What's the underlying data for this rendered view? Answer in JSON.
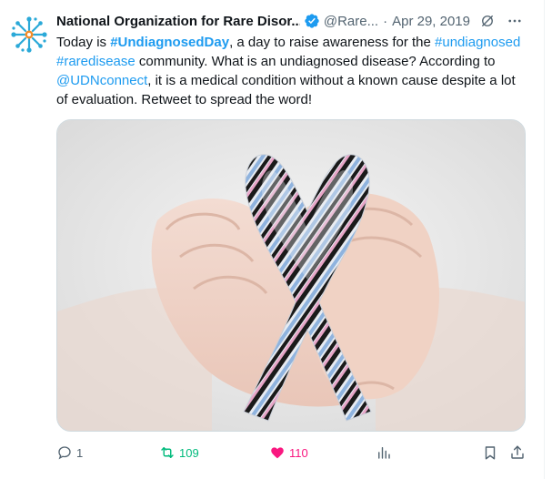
{
  "tweet": {
    "author_name": "National Organization for Rare Disor...",
    "handle": "@Rare...",
    "separator": "·",
    "date": "Apr 29, 2019",
    "text_parts": {
      "p1": "Today is ",
      "tag1": "#UndiagnosedDay",
      "p2": ", a day to raise awareness for the ",
      "tag2": "#undiagnosed",
      "p3": " ",
      "tag3": "#raredisease",
      "p4": " community. What is an undiagnosed disease? According to ",
      "mention": "@UDNconnect",
      "p5": ", it is a medical condition without a known cause despite a lot of evaluation. Retweet to spread the word!"
    },
    "media": {
      "icon": "hands-holding-zebra-ribbon-photo"
    }
  },
  "actions": {
    "replies": "1",
    "retweets": "109",
    "likes": "110",
    "views": "",
    "colors": {
      "retweet": "#00ba7c",
      "like": "#f91880",
      "link": "#1d9bf0",
      "muted": "#536471"
    }
  },
  "icons": [
    "avatar-logo",
    "verified-badge-icon",
    "grok-icon",
    "more-icon",
    "reply-icon",
    "retweet-icon",
    "heart-icon",
    "views-icon",
    "bookmark-icon",
    "share-icon"
  ]
}
